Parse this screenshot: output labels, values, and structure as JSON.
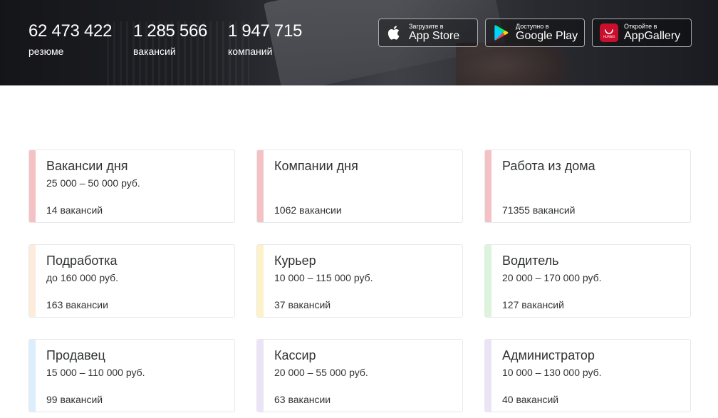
{
  "stats": [
    {
      "value": "62 473 422",
      "label": "резюме"
    },
    {
      "value": "1 285 566",
      "label": "вакансий"
    },
    {
      "value": "1 947 715",
      "label": "компаний"
    }
  ],
  "stores": {
    "appstore": {
      "top": "Загрузите в",
      "name": "App Store",
      "icon": "apple-icon"
    },
    "googleplay": {
      "top": "Доступно в",
      "name": "Google Play",
      "icon": "google-play-icon"
    },
    "appgallery": {
      "top": "Откройте в",
      "name": "AppGallery",
      "icon": "huawei-icon",
      "icon_text": "HUAWEI",
      "icon_color": "#c8102e"
    }
  },
  "cards": [
    {
      "title": "Вакансии дня",
      "salary": "25 000 – 50 000 руб.",
      "count": "14 вакансий",
      "accent": "#f4c2c4"
    },
    {
      "title": "Компании дня",
      "salary": "",
      "count": "1062 вакансии",
      "accent": "#f4c2c4"
    },
    {
      "title": "Работа из дома",
      "salary": "",
      "count": "71355 вакансий",
      "accent": "#f4c2c4"
    },
    {
      "title": "Подработка",
      "salary": "до 160 000 руб.",
      "count": "163 вакансии",
      "accent": "#fdebdc"
    },
    {
      "title": "Курьер",
      "salary": "10 000 – 115 000 руб.",
      "count": "37 вакансий",
      "accent": "#fdf1c7"
    },
    {
      "title": "Водитель",
      "salary": "20 000 – 170 000 руб.",
      "count": "127 вакансий",
      "accent": "#dcf3dc"
    },
    {
      "title": "Продавец",
      "salary": "15 000 – 110 000 руб.",
      "count": "99 вакансий",
      "accent": "#dceefb"
    },
    {
      "title": "Кассир",
      "salary": "20 000 – 55 000 руб.",
      "count": "63 вакансии",
      "accent": "#ebe4f7"
    },
    {
      "title": "Администратор",
      "salary": "10 000 – 130 000 руб.",
      "count": "40 вакансий",
      "accent": "#ebe4f7"
    }
  ]
}
